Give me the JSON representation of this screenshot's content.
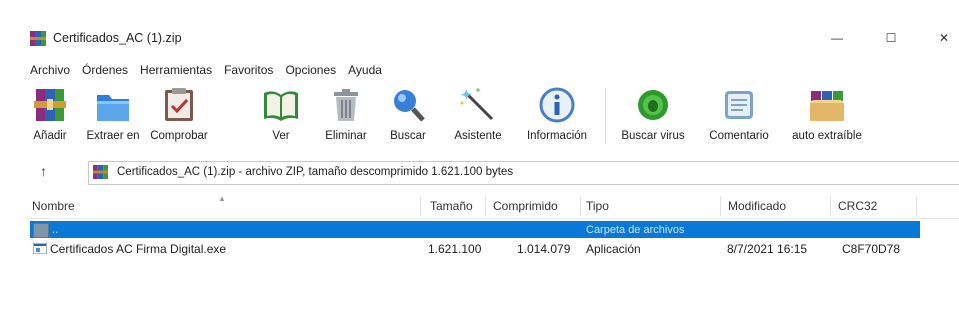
{
  "window": {
    "title": "Certificados_AC (1).zip",
    "min_glyph": "—",
    "max_glyph": "☐",
    "close_glyph": "✕"
  },
  "menu": [
    "Archivo",
    "Órdenes",
    "Herramientas",
    "Favoritos",
    "Opciones",
    "Ayuda"
  ],
  "toolbar": {
    "add": "Añadir",
    "extract": "Extraer en",
    "test": "Comprobar",
    "view": "Ver",
    "delete": "Eliminar",
    "find": "Buscar",
    "wizard": "Asistente",
    "info": "Información",
    "virus": "Buscar virus",
    "comment": "Comentario",
    "sfx": "auto extraíble"
  },
  "address": {
    "up_glyph": "↑",
    "text": "Certificados_AC (1).zip - archivo ZIP, tamaño descomprimido 1.621.100 bytes"
  },
  "columns": {
    "name": "Nombre",
    "size": "Tamaño",
    "packed": "Comprimido",
    "type": "Tipo",
    "modified": "Modificado",
    "crc": "CRC32"
  },
  "rows": [
    {
      "name": "..",
      "size": "",
      "packed": "",
      "type": "Carpeta de archivos",
      "modified": "",
      "crc": ""
    },
    {
      "name": "Certificados AC Firma Digital.exe",
      "size": "1.621.100",
      "packed": "1.014.079",
      "type": "Aplicación",
      "modified": "8/7/2021 16:15",
      "crc": "C8F70D78"
    }
  ],
  "colors": {
    "selection": "#0a78d7"
  }
}
